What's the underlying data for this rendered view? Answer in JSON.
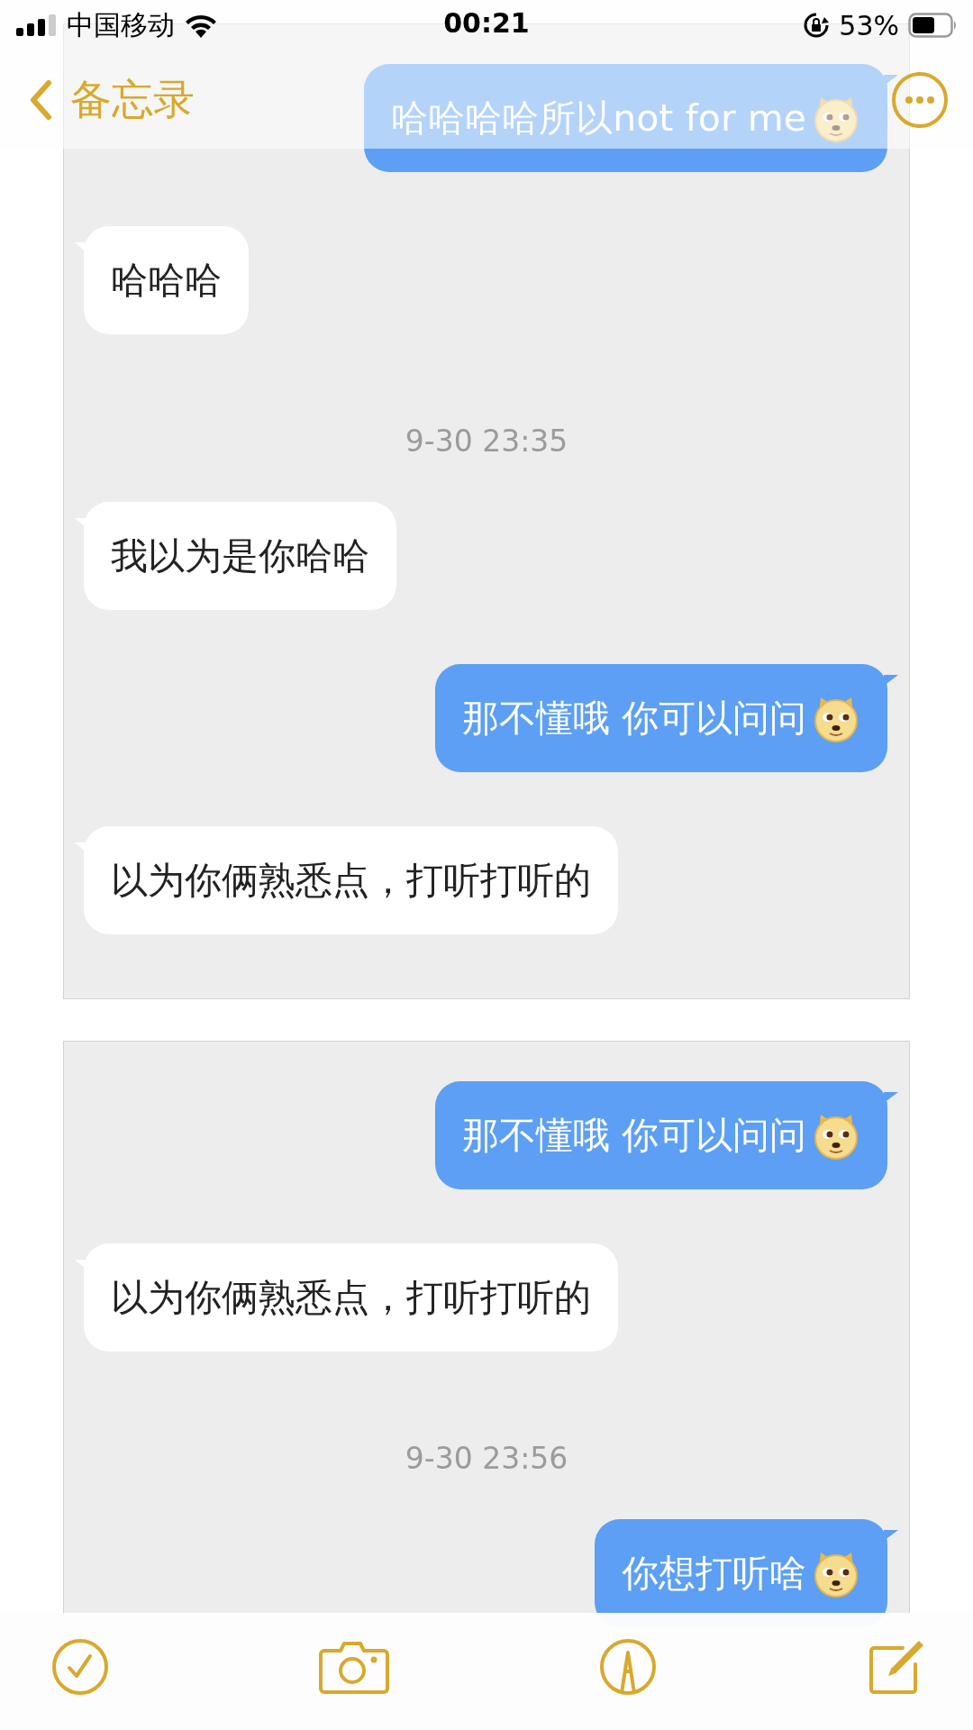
{
  "status_bar": {
    "carrier": "中国移动",
    "time": "00:21",
    "battery": "53%"
  },
  "nav_bar": {
    "back_label": "备忘录"
  },
  "screenshots": [
    {
      "messages": [
        {
          "kind": "sent",
          "text": "哈哈哈哈所以not for me",
          "emoji": true
        },
        {
          "kind": "received",
          "text": "哈哈哈",
          "emoji": false
        },
        {
          "kind": "time",
          "text": "9-30 23:35"
        },
        {
          "kind": "received",
          "text": "我以为是你哈哈",
          "emoji": false
        },
        {
          "kind": "sent",
          "text": "那不懂哦 你可以问问",
          "emoji": true
        },
        {
          "kind": "received",
          "text": "以为你俩熟悉点，打听打听的",
          "emoji": false
        }
      ]
    },
    {
      "messages": [
        {
          "kind": "sent",
          "text": "那不懂哦 你可以问问",
          "emoji": true
        },
        {
          "kind": "received",
          "text": "以为你俩熟悉点，打听打听的",
          "emoji": false
        },
        {
          "kind": "time",
          "text": "9-30 23:56"
        },
        {
          "kind": "sent",
          "text": "你想打听啥",
          "emoji": true
        }
      ]
    }
  ]
}
